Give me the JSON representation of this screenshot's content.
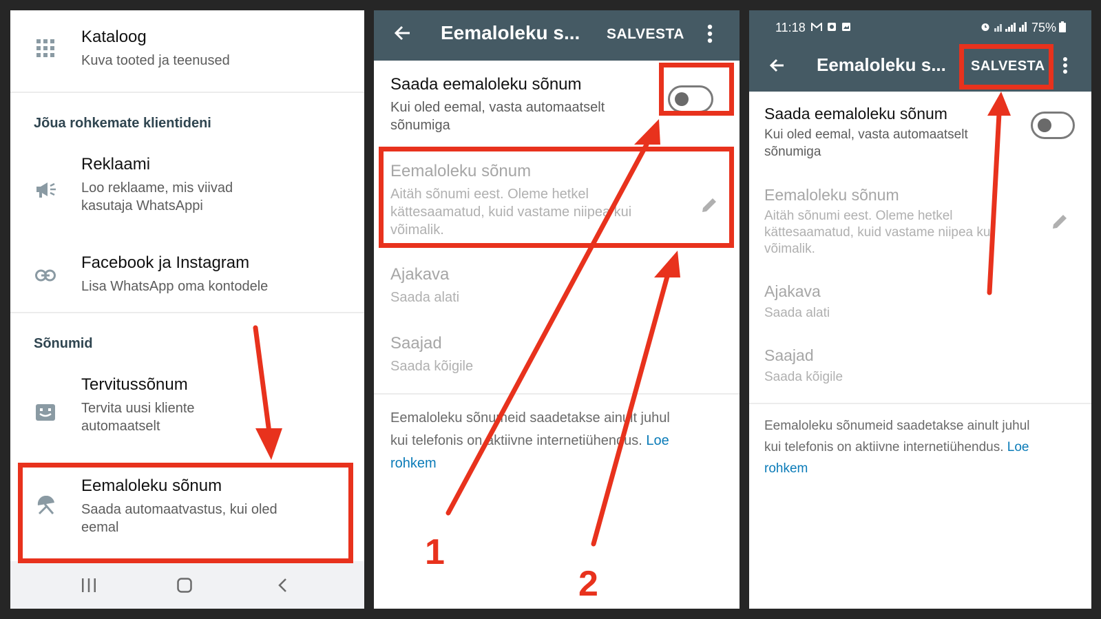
{
  "panel1": {
    "catalog": {
      "title": "Kataloog",
      "subtitle": "Kuva tooted ja teenused",
      "icon": "grid-icon"
    },
    "section_reach": "Jõua rohkemate klientideni",
    "ads": {
      "title": "Reklaami",
      "subtitle_line1": "Loo reklaame, mis viivad",
      "subtitle_line2": "kasutaja WhatsAppi",
      "icon": "megaphone-icon"
    },
    "facebook": {
      "title": "Facebook ja Instagram",
      "subtitle": "Lisa WhatsApp oma kontodele",
      "icon": "link-icon"
    },
    "section_messages": "Sõnumid",
    "greeting": {
      "title": "Tervitussõnum",
      "subtitle_line1": "Tervita uusi kliente",
      "subtitle_line2": "automaatselt",
      "icon": "greeting-icon"
    },
    "away": {
      "title": "Eemaloleku sõnum",
      "subtitle_line1": "Saada automaatvastus, kui oled",
      "subtitle_line2": "eemal",
      "icon": "away-icon"
    }
  },
  "panel2": {
    "appbar_title": "Eemaloleku s...",
    "save_label": "SALVESTA",
    "send_away": {
      "title": "Saada eemaloleku sõnum",
      "subtitle_line1": "Kui oled eemal, vasta automaatselt",
      "subtitle_line2": "sõnumiga",
      "toggle_on": false
    },
    "away_message": {
      "title": "Eemaloleku sõnum",
      "line1": "Aitäh sõnumi eest. Oleme hetkel",
      "line2": "kättesaamatud, kuid vastame niipea kui",
      "line3": "võimalik."
    },
    "schedule": {
      "title": "Ajakava",
      "value": "Saada alati"
    },
    "recipients": {
      "title": "Saajad",
      "value": "Saada kõigile"
    },
    "footer_line1": "Eemaloleku sõnumeid saadetakse ainult juhul",
    "footer_line2": "kui telefonis on aktiivne internetiühendus.",
    "footer_link_part1": "Loe",
    "footer_link_part2": "rohkem"
  },
  "panel3": {
    "status_time": "11:18",
    "status_battery": "75%",
    "appbar_title": "Eemaloleku s...",
    "save_label": "SALVESTA",
    "send_away": {
      "title": "Saada eemaloleku sõnum",
      "subtitle_line1": "Kui oled eemal, vasta automaatselt",
      "subtitle_line2": "sõnumiga",
      "toggle_on": false
    },
    "away_message": {
      "title": "Eemaloleku sõnum",
      "line1": "Aitäh sõnumi eest. Oleme hetkel",
      "line2": "kättesaamatud, kuid vastame niipea kui",
      "line3": "võimalik."
    },
    "schedule": {
      "title": "Ajakava",
      "value": "Saada alati"
    },
    "recipients": {
      "title": "Saajad",
      "value": "Saada kõigile"
    },
    "footer_line1": "Eemaloleku sõnumeid saadetakse ainult juhul",
    "footer_line2": "kui telefonis on aktiivne internetiühendus.",
    "footer_link_part1": "Loe",
    "footer_link_part2": "rohkem"
  },
  "annotations": {
    "step1": "1",
    "step2": "2",
    "highlight_color": "#e8321d"
  },
  "colors": {
    "appbar": "#455a64",
    "link": "#0a7bb8",
    "background": "#262626"
  }
}
